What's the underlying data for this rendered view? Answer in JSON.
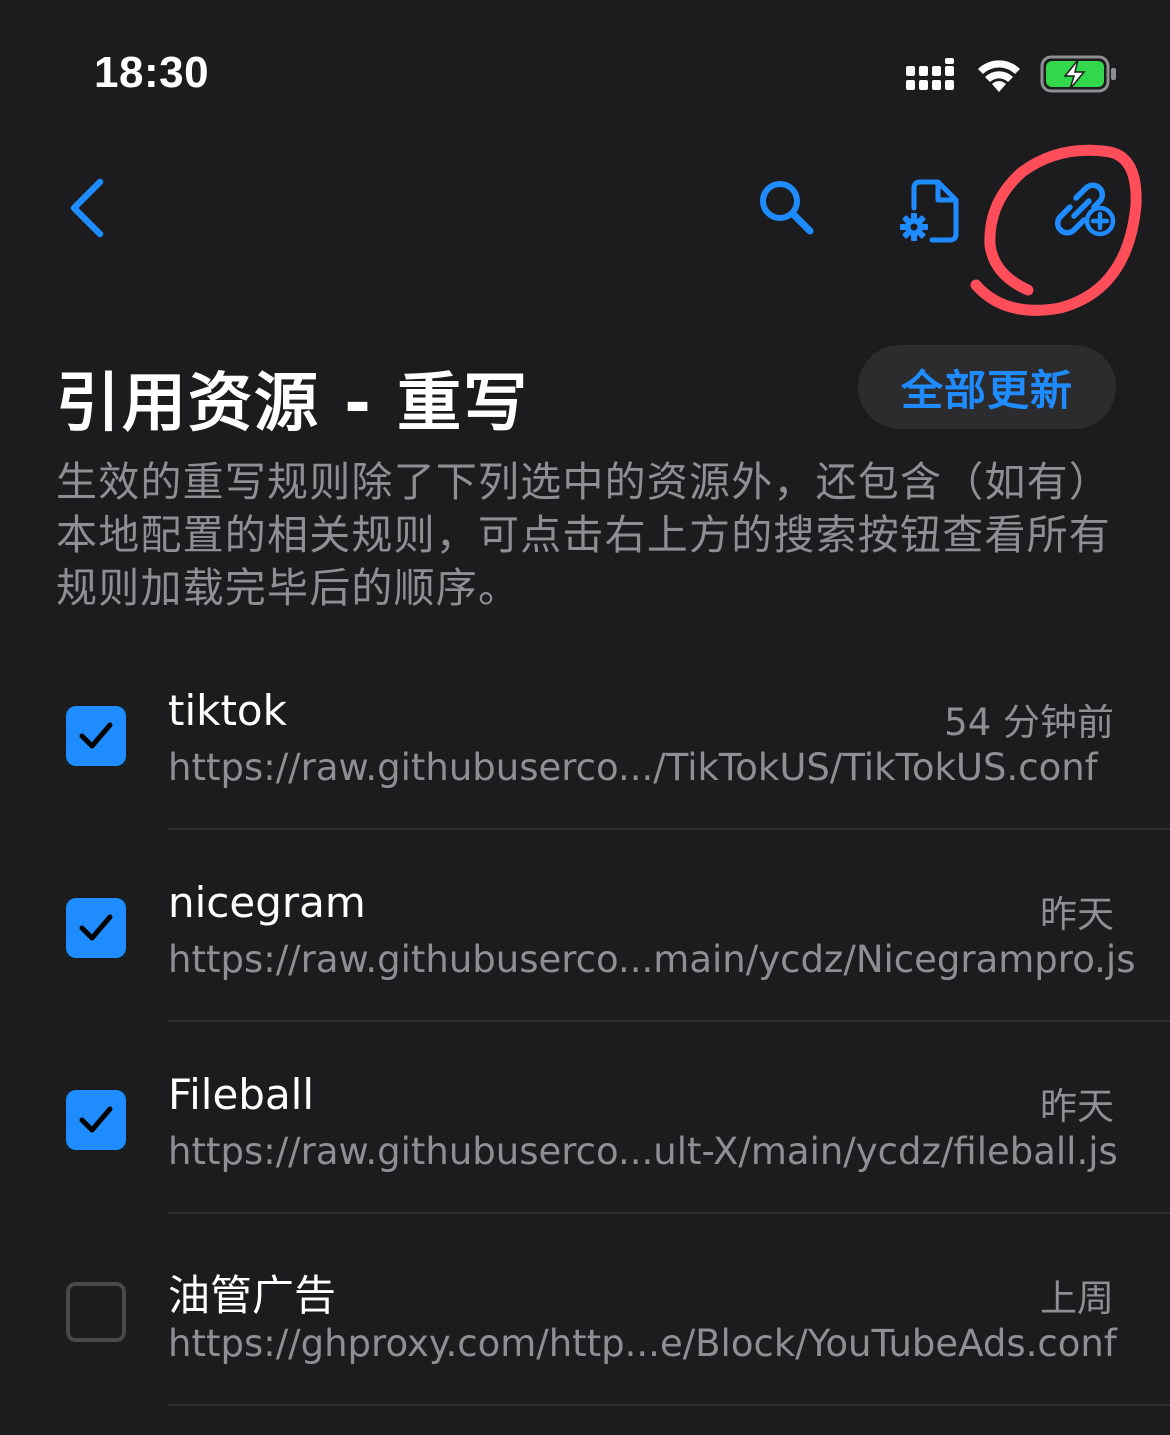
{
  "status_bar": {
    "time": "18:30"
  },
  "nav": {
    "back_icon": "chevron-left-icon",
    "search_icon": "search-icon",
    "config_icon": "file-gear-icon",
    "add_link_icon": "link-plus-icon"
  },
  "header": {
    "title": "引用资源 - 重写",
    "update_all_label": "全部更新",
    "description": "生效的重写规则除了下列选中的资源外，还包含（如有）本地配置的相关规则，可点击右上方的搜索按钮查看所有规则加载完毕后的顺序。"
  },
  "resources": [
    {
      "name": "tiktok",
      "time": "54 分钟前",
      "url": "https://raw.githubuserco.../TikTokUS/TikTokUS.conf",
      "checked": true
    },
    {
      "name": "nicegram",
      "time": "昨天",
      "url": "https://raw.githubuserco...main/ycdz/Nicegrampro.js",
      "checked": true
    },
    {
      "name": "Fileball",
      "time": "昨天",
      "url": "https://raw.githubuserco...ult-X/main/ycdz/fileball.js",
      "checked": true
    },
    {
      "name": "油管广告",
      "time": "上周",
      "url": "https://ghproxy.com/http...e/Block/YouTubeAds.conf",
      "checked": false
    }
  ],
  "colors": {
    "background": "#1c1c1e",
    "accent": "#1e8bff",
    "secondary_text": "#8e8e93",
    "annotation": "#ff4d5a"
  }
}
